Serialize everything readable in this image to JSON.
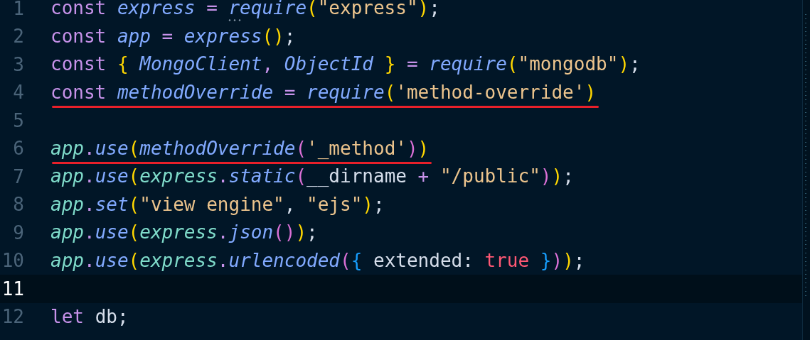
{
  "editor": {
    "lines": [
      {
        "number": "1",
        "underlined": false,
        "tokens": [
          {
            "kind": "keyword",
            "text": "const "
          },
          {
            "kind": "variable",
            "text": "express"
          },
          {
            "kind": "operator",
            "text": " = "
          },
          {
            "kind": "function",
            "text": "require",
            "hint": true
          },
          {
            "kind": "bracket1",
            "text": "("
          },
          {
            "kind": "string",
            "text": "\"express\""
          },
          {
            "kind": "bracket1",
            "text": ")"
          },
          {
            "kind": "plain",
            "text": ";"
          }
        ]
      },
      {
        "number": "2",
        "underlined": false,
        "tokens": [
          {
            "kind": "keyword",
            "text": "const "
          },
          {
            "kind": "variable",
            "text": "app"
          },
          {
            "kind": "operator",
            "text": " = "
          },
          {
            "kind": "function",
            "text": "express"
          },
          {
            "kind": "bracket1",
            "text": "()"
          },
          {
            "kind": "plain",
            "text": ";"
          }
        ]
      },
      {
        "number": "3",
        "underlined": false,
        "tokens": [
          {
            "kind": "keyword",
            "text": "const "
          },
          {
            "kind": "bracket1",
            "text": "{"
          },
          {
            "kind": "variable",
            "text": " MongoClient"
          },
          {
            "kind": "operator",
            "text": ","
          },
          {
            "kind": "variable",
            "text": " ObjectId "
          },
          {
            "kind": "bracket1",
            "text": "}"
          },
          {
            "kind": "operator",
            "text": " = "
          },
          {
            "kind": "function",
            "text": "require"
          },
          {
            "kind": "bracket1",
            "text": "("
          },
          {
            "kind": "string",
            "text": "\"mongodb\""
          },
          {
            "kind": "bracket1",
            "text": ")"
          },
          {
            "kind": "plain",
            "text": ";"
          }
        ]
      },
      {
        "number": "4",
        "underlined": true,
        "tokens": [
          {
            "kind": "keyword",
            "text": "const "
          },
          {
            "kind": "variable",
            "text": "methodOverride"
          },
          {
            "kind": "operator",
            "text": " = "
          },
          {
            "kind": "function",
            "text": "require"
          },
          {
            "kind": "bracket1",
            "text": "("
          },
          {
            "kind": "string",
            "text": "'method-override'"
          },
          {
            "kind": "bracket1",
            "text": ")"
          }
        ]
      },
      {
        "number": "5",
        "underlined": false
      },
      {
        "number": "6",
        "underlined": true,
        "tokens": [
          {
            "kind": "object",
            "text": "app"
          },
          {
            "kind": "operator",
            "text": "."
          },
          {
            "kind": "function",
            "text": "use"
          },
          {
            "kind": "bracket1",
            "text": "("
          },
          {
            "kind": "function",
            "text": "methodOverride"
          },
          {
            "kind": "bracket2",
            "text": "("
          },
          {
            "kind": "string",
            "text": "'_method'"
          },
          {
            "kind": "bracket2",
            "text": ")"
          },
          {
            "kind": "bracket1",
            "text": ")"
          }
        ]
      },
      {
        "number": "7",
        "underlined": false,
        "tokens": [
          {
            "kind": "object",
            "text": "app"
          },
          {
            "kind": "operator",
            "text": "."
          },
          {
            "kind": "function",
            "text": "use"
          },
          {
            "kind": "bracket1",
            "text": "("
          },
          {
            "kind": "object",
            "text": "express"
          },
          {
            "kind": "operator",
            "text": "."
          },
          {
            "kind": "function",
            "text": "static"
          },
          {
            "kind": "bracket2",
            "text": "("
          },
          {
            "kind": "plain",
            "text": "__dirname "
          },
          {
            "kind": "operator",
            "text": "+"
          },
          {
            "kind": "string",
            "text": " \"/public\""
          },
          {
            "kind": "bracket2",
            "text": ")"
          },
          {
            "kind": "bracket1",
            "text": ")"
          },
          {
            "kind": "plain",
            "text": ";"
          }
        ]
      },
      {
        "number": "8",
        "underlined": false,
        "tokens": [
          {
            "kind": "object",
            "text": "app"
          },
          {
            "kind": "operator",
            "text": "."
          },
          {
            "kind": "function",
            "text": "set"
          },
          {
            "kind": "bracket1",
            "text": "("
          },
          {
            "kind": "string",
            "text": "\"view engine\""
          },
          {
            "kind": "plain",
            "text": ", "
          },
          {
            "kind": "string",
            "text": "\"ejs\""
          },
          {
            "kind": "bracket1",
            "text": ")"
          },
          {
            "kind": "plain",
            "text": ";"
          }
        ]
      },
      {
        "number": "9",
        "underlined": false,
        "tokens": [
          {
            "kind": "object",
            "text": "app"
          },
          {
            "kind": "operator",
            "text": "."
          },
          {
            "kind": "function",
            "text": "use"
          },
          {
            "kind": "bracket1",
            "text": "("
          },
          {
            "kind": "object",
            "text": "express"
          },
          {
            "kind": "operator",
            "text": "."
          },
          {
            "kind": "function",
            "text": "json"
          },
          {
            "kind": "bracket2",
            "text": "()"
          },
          {
            "kind": "bracket1",
            "text": ")"
          },
          {
            "kind": "plain",
            "text": ";"
          }
        ]
      },
      {
        "number": "10",
        "underlined": false,
        "tokens": [
          {
            "kind": "object",
            "text": "app"
          },
          {
            "kind": "operator",
            "text": "."
          },
          {
            "kind": "function",
            "text": "use"
          },
          {
            "kind": "bracket1",
            "text": "("
          },
          {
            "kind": "object",
            "text": "express"
          },
          {
            "kind": "operator",
            "text": "."
          },
          {
            "kind": "function",
            "text": "urlencoded"
          },
          {
            "kind": "bracket2",
            "text": "("
          },
          {
            "kind": "bracket3",
            "text": "{"
          },
          {
            "kind": "plain",
            "text": " extended: "
          },
          {
            "kind": "literal",
            "text": "true "
          },
          {
            "kind": "bracket3",
            "text": "}"
          },
          {
            "kind": "bracket2",
            "text": ")"
          },
          {
            "kind": "bracket1",
            "text": ")"
          },
          {
            "kind": "plain",
            "text": ";"
          }
        ]
      },
      {
        "number": "11",
        "underlined": false,
        "current": true
      },
      {
        "number": "12",
        "underlined": false,
        "tokens": [
          {
            "kind": "keyword",
            "text": "let "
          },
          {
            "kind": "plain",
            "text": "db;"
          }
        ]
      }
    ]
  }
}
